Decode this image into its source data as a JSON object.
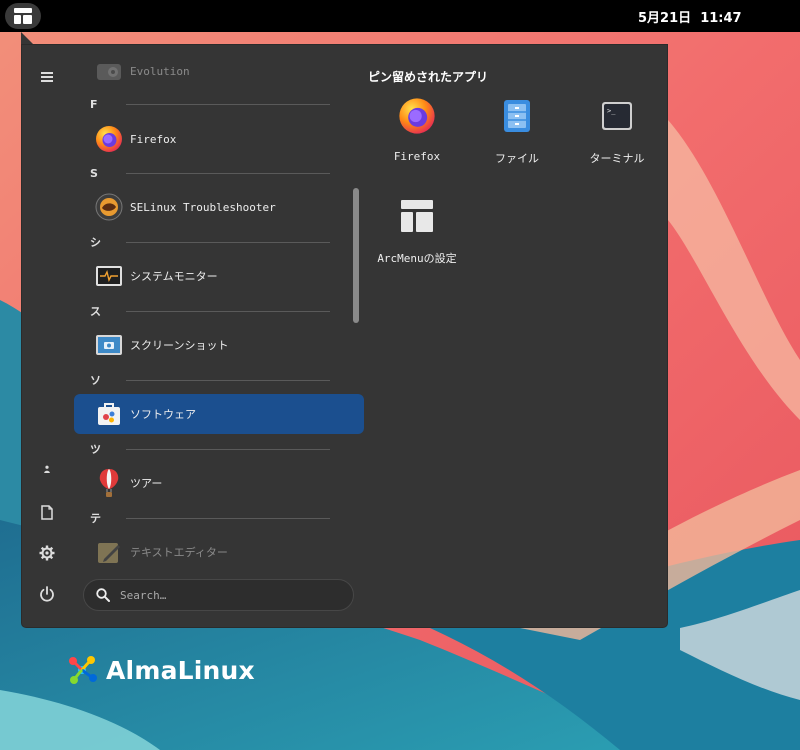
{
  "topbar": {
    "clock": "5月21日  11:47",
    "activities_icon": "arcmenu-icon"
  },
  "menu": {
    "sidebar": [
      {
        "name": "hamburger-icon"
      },
      {
        "name": "user-icon"
      },
      {
        "name": "document-icon"
      },
      {
        "name": "settings-icon"
      },
      {
        "name": "power-icon"
      }
    ],
    "app_list": [
      {
        "type": "app",
        "label": "Evolution",
        "icon": "evolution-icon",
        "dim": true
      },
      {
        "type": "section",
        "letter": "F"
      },
      {
        "type": "app",
        "label": "Firefox",
        "icon": "firefox-icon"
      },
      {
        "type": "section",
        "letter": "S"
      },
      {
        "type": "app",
        "label": "SELinux Troubleshooter",
        "icon": "selinux-icon"
      },
      {
        "type": "section",
        "letter": "シ"
      },
      {
        "type": "app",
        "label": "システムモニター",
        "icon": "system-monitor-icon"
      },
      {
        "type": "section",
        "letter": "ス"
      },
      {
        "type": "app",
        "label": "スクリーンショット",
        "icon": "screenshot-icon"
      },
      {
        "type": "section",
        "letter": "ソ"
      },
      {
        "type": "app",
        "label": "ソフトウェア",
        "icon": "software-icon",
        "selected": true
      },
      {
        "type": "section",
        "letter": "ツ"
      },
      {
        "type": "app",
        "label": "ツアー",
        "icon": "tour-icon"
      },
      {
        "type": "section",
        "letter": "テ"
      },
      {
        "type": "app",
        "label": "テキストエディター",
        "icon": "text-editor-icon",
        "dim": true
      }
    ],
    "search": {
      "placeholder": "Search…"
    },
    "pinned": {
      "title": "ピン留めされたアプリ",
      "items": [
        {
          "label": "Firefox",
          "icon": "firefox-icon"
        },
        {
          "label": "ファイル",
          "icon": "files-icon"
        },
        {
          "label": "ターミナル",
          "icon": "terminal-icon"
        },
        {
          "label": "ArcMenuの設定",
          "icon": "arcmenu-settings-icon"
        }
      ]
    }
  },
  "desktop": {
    "brand": "AlmaLinux"
  },
  "colors": {
    "menu_bg": "#353535",
    "selected": "#1b4f8f",
    "topbar": "#000000"
  }
}
